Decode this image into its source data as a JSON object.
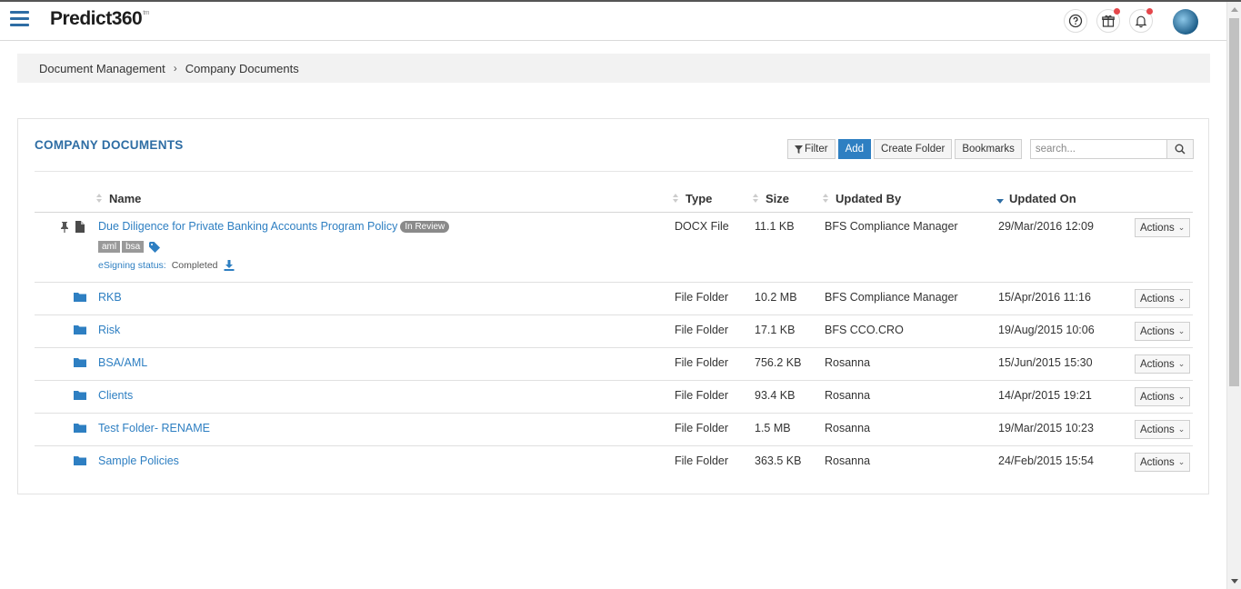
{
  "header": {
    "logo_text": "Predict360",
    "logo_mark": "tm",
    "help_icon": "question-circle-icon",
    "gift_icon": "gift-icon",
    "bell_icon": "bell-icon",
    "notification_color": "#e5474b"
  },
  "breadcrumb": {
    "items": [
      "Document Management",
      "Company Documents"
    ],
    "separator": "›"
  },
  "panel": {
    "title": "COMPANY DOCUMENTS",
    "toolbar": {
      "filter_label": "Filter",
      "add_label": "Add",
      "create_folder_label": "Create Folder",
      "bookmarks_label": "Bookmarks",
      "search_placeholder": "search..."
    }
  },
  "table": {
    "columns": [
      "Name",
      "Type",
      "Size",
      "Updated By",
      "Updated On"
    ],
    "sorted_column": "Updated On",
    "actions_label": "Actions",
    "document": {
      "name": "Due Diligence for Private Banking Accounts Program Policy",
      "status_badge": "In Review",
      "tags": [
        "aml",
        "bsa"
      ],
      "esign_label": "eSigning status:",
      "esign_value": "Completed",
      "type": "DOCX File",
      "size": "11.1 KB",
      "updated_by": "BFS Compliance Manager",
      "updated_on": "29/Mar/2016 12:09"
    },
    "folders": [
      {
        "name": "RKB",
        "type": "File Folder",
        "size": "10.2 MB",
        "updated_by": "BFS Compliance Manager",
        "updated_on": "15/Apr/2016 11:16"
      },
      {
        "name": "Risk",
        "type": "File Folder",
        "size": "17.1 KB",
        "updated_by": "BFS CCO.CRO",
        "updated_on": "19/Aug/2015 10:06"
      },
      {
        "name": "BSA/AML",
        "type": "File Folder",
        "size": "756.2 KB",
        "updated_by": "Rosanna",
        "updated_on": "15/Jun/2015 15:30"
      },
      {
        "name": "Clients",
        "type": "File Folder",
        "size": "93.4 KB",
        "updated_by": "Rosanna",
        "updated_on": "14/Apr/2015 19:21"
      },
      {
        "name": "Test Folder- RENAME",
        "type": "File Folder",
        "size": "1.5 MB",
        "updated_by": "Rosanna",
        "updated_on": "19/Mar/2015 10:23"
      },
      {
        "name": "Sample Policies",
        "type": "File Folder",
        "size": "363.5 KB",
        "updated_by": "Rosanna",
        "updated_on": "24/Feb/2015 15:54"
      }
    ]
  }
}
